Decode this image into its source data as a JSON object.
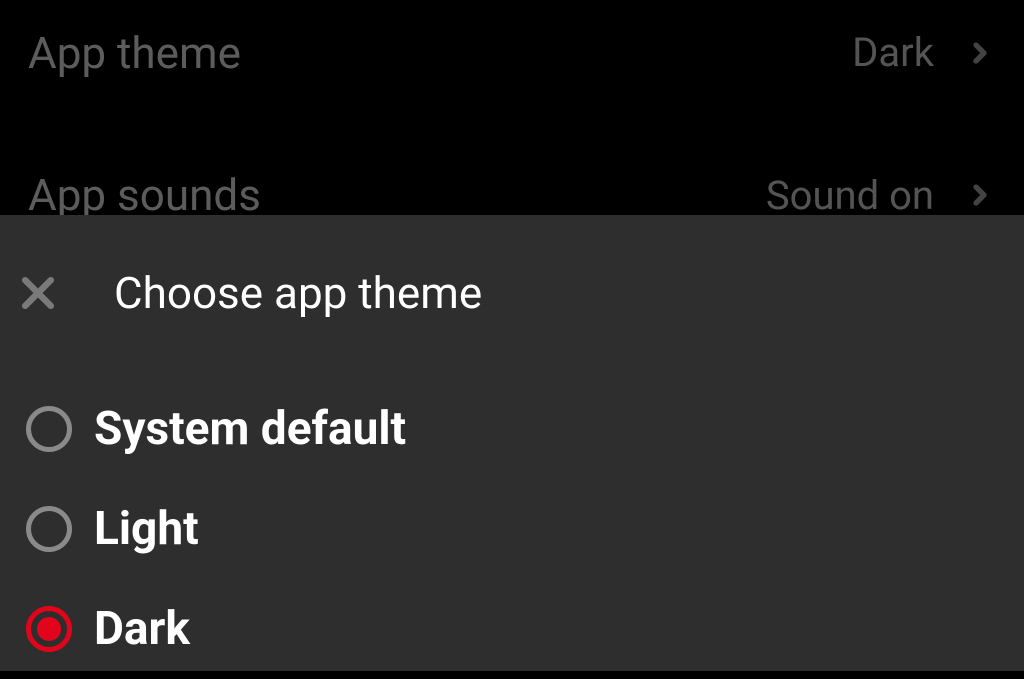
{
  "settings": {
    "theme": {
      "label": "App theme",
      "value": "Dark"
    },
    "sounds": {
      "label": "App sounds",
      "value": "Sound on"
    }
  },
  "modal": {
    "title": "Choose app theme",
    "options": [
      {
        "label": "System default",
        "selected": false
      },
      {
        "label": "Light",
        "selected": false
      },
      {
        "label": "Dark",
        "selected": true
      }
    ]
  },
  "colors": {
    "accent": "#e2041a",
    "modal_bg": "#2e2e2e",
    "bg": "#000000"
  }
}
